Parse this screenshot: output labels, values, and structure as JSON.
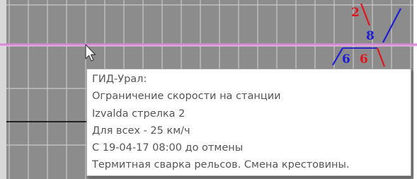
{
  "graph": {
    "colors": {
      "background_grid": "#8c8c8c",
      "grid_line": "#c8c8c8",
      "station_line": "#d98ad6",
      "red_train": "#e0141e",
      "blue_train": "#1e1ed2",
      "black_line": "#000000"
    },
    "train_labels": [
      {
        "text": "2",
        "color": "red"
      },
      {
        "text": "8",
        "color": "blue"
      },
      {
        "text": "6",
        "color": "blue"
      },
      {
        "text": "6",
        "color": "red"
      }
    ]
  },
  "cursor": {
    "icon": "mouse-pointer-icon"
  },
  "tooltip": {
    "title": "ГИД-Урал:",
    "lines": [
      "Ограничение скорости на станции",
      "Izvalda   стрелка 2",
      "Для всех - 25 км/ч",
      "С 19-04-17 08:00 до отмены",
      "Термитная  сварка   рельсов. Смена крестовины."
    ]
  }
}
